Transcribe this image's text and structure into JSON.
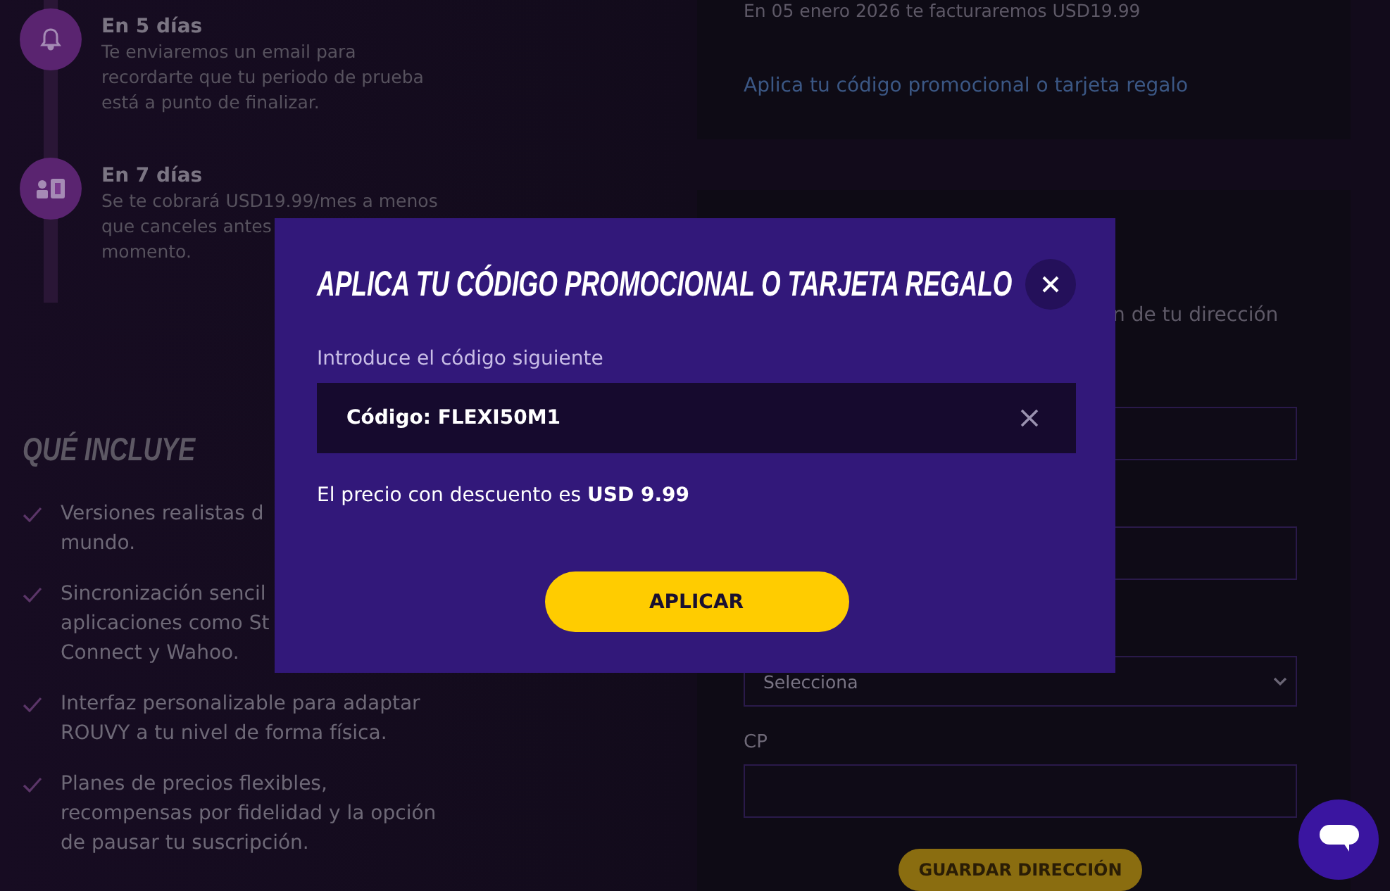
{
  "timeline": [
    {
      "kind": "reminder",
      "title": "En 5 días",
      "lines": [
        "Te enviaremos un email para",
        "recordarte que tu periodo de prueba",
        "está a punto de finalizar."
      ]
    },
    {
      "kind": "billing",
      "title": "En 7 días",
      "lines": [
        "Se te cobrará USD19.99/mes a menos",
        "que canceles antes",
        "momento."
      ]
    }
  ],
  "includes": {
    "heading": "QUÉ INCLUYE",
    "items": [
      {
        "lines": [
          "Versiones realistas d",
          "mundo."
        ]
      },
      {
        "lines": [
          "Sincronización sencil",
          "aplicaciones como St",
          "Connect y Wahoo."
        ]
      },
      {
        "lines": [
          "Interfaz personalizable para adaptar",
          "ROUVY a tu nivel de forma física."
        ]
      },
      {
        "lines": [
          "Planes de precios flexibles,",
          "recompensas por fidelidad y la opción",
          "de pausar tu suscripción."
        ]
      }
    ]
  },
  "billing": {
    "note": "En 05 enero 2026 te facturaremos USD19.99",
    "promo_link": "Aplica tu código promocional o tarjeta regalo"
  },
  "address": {
    "intro_fragment": "n de tu dirección",
    "select_placeholder": "Selecciona",
    "postcode_label": "CP",
    "save_button": "GUARDAR DIRECCIÓN"
  },
  "modal": {
    "title": "APLICA TU CÓDIGO PROMOCIONAL O TARJETA REGALO",
    "field_label": "Introduce el código siguiente",
    "code_value": "Código: FLEXI50M1",
    "price_text": "El precio con descuento es **USD 9.99**",
    "apply_button": "APLICAR"
  }
}
